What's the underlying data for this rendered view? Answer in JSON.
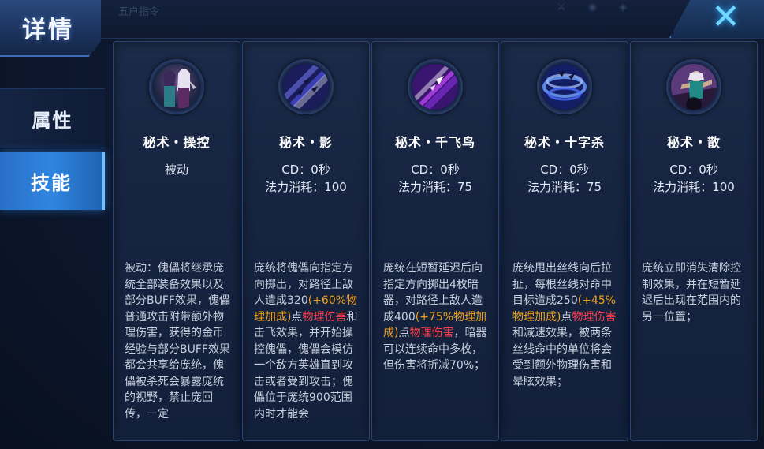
{
  "header": {
    "title": "详情",
    "faded_text": "五户指令"
  },
  "sidebar": {
    "items": [
      {
        "label": "属性"
      },
      {
        "label": "技能"
      }
    ]
  },
  "colors": {
    "accent": "#2f86df",
    "bonus_orange": "#f2a11c",
    "physical_red": "#ff3d4a"
  },
  "skills": [
    {
      "name": "秘术・操控",
      "line1": "被动",
      "line2": "",
      "icon": "puppet-skill-icon",
      "desc": [
        {
          "t": "被动：傀儡将继承庞统全部装备效果以及部分BUFF效果，傀儡普通攻击附带额外物理伤害，获得的金币经验与部分BUFF效果都会共享给庞统，傀儡被杀死会暴露庞统的视野，禁止庞回传，一定",
          "c": "n"
        }
      ]
    },
    {
      "name": "秘术・影",
      "line1": "CD：0秒",
      "line2": "法力消耗：100",
      "icon": "shadow-skill-icon",
      "desc": [
        {
          "t": "庞统将傀儡向指定方向掷出，对路径上敌人造成320",
          "c": "n"
        },
        {
          "t": "(+60%物理加成)",
          "c": "o"
        },
        {
          "t": "点",
          "c": "n"
        },
        {
          "t": "物理伤害",
          "c": "r"
        },
        {
          "t": "和击飞效果，并开始操控傀儡，傀儡会模仿一个敌方英雄直到攻击或者受到攻击；傀儡位于庞统900范围内时才能会",
          "c": "n"
        }
      ]
    },
    {
      "name": "秘术・千飞鸟",
      "line1": "CD：0秒",
      "line2": "法力消耗：75",
      "icon": "thousand-birds-skill-icon",
      "desc": [
        {
          "t": "庞统在短暂延迟后向指定方向掷出4枚暗器，对路径上敌人造成400",
          "c": "n"
        },
        {
          "t": "(+75%物理加成)",
          "c": "o"
        },
        {
          "t": "点",
          "c": "n"
        },
        {
          "t": "物理伤害",
          "c": "r"
        },
        {
          "t": "，暗器可以连续命中多枚，但伤害将折减70%；",
          "c": "n"
        }
      ]
    },
    {
      "name": "秘术・十字杀",
      "line1": "CD：0秒",
      "line2": "法力消耗：75",
      "icon": "cross-slash-skill-icon",
      "desc": [
        {
          "t": "庞统甩出丝线向后拉扯，每根丝线对命中目标造成250",
          "c": "n"
        },
        {
          "t": "(+45%物理加成)",
          "c": "o"
        },
        {
          "t": "点",
          "c": "n"
        },
        {
          "t": "物理伤害",
          "c": "r"
        },
        {
          "t": "和减速效果，被两条丝线命中的单位将会受到额外物理伤害和晕眩效果；",
          "c": "n"
        }
      ]
    },
    {
      "name": "秘术・散",
      "line1": "CD：0秒",
      "line2": "法力消耗：100",
      "icon": "scatter-skill-icon",
      "desc": [
        {
          "t": "庞统立即消失清除控制效果，并在短暂延迟后出现在范围内的另一位置；",
          "c": "n"
        }
      ]
    }
  ]
}
